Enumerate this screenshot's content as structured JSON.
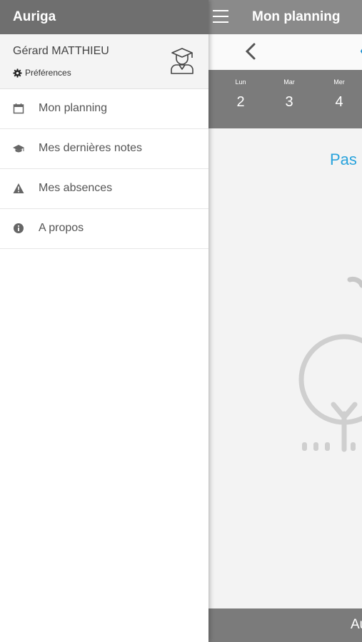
{
  "drawer": {
    "app_name": "Auriga",
    "user_name": "Gérard MATTHIEU",
    "preferences_label": "Préférences",
    "menu": [
      {
        "label": "Mon planning",
        "icon": "calendar-icon"
      },
      {
        "label": "Mes dernières notes",
        "icon": "graduation-cap-icon"
      },
      {
        "label": "Mes absences",
        "icon": "warning-icon"
      },
      {
        "label": "A propos",
        "icon": "info-icon"
      }
    ]
  },
  "main": {
    "title": "Mon planning",
    "days": [
      {
        "name": "Lun",
        "num": "2"
      },
      {
        "name": "Mar",
        "num": "3"
      },
      {
        "name": "Mer",
        "num": "4"
      }
    ],
    "empty_text_visible": "Pas",
    "bottom_text_visible": "Au"
  },
  "colors": {
    "drawer_header": "#6f6f6f",
    "main_header": "#8a8a8a",
    "days_bar": "#7b7b7b",
    "accent": "#29a3dc"
  }
}
